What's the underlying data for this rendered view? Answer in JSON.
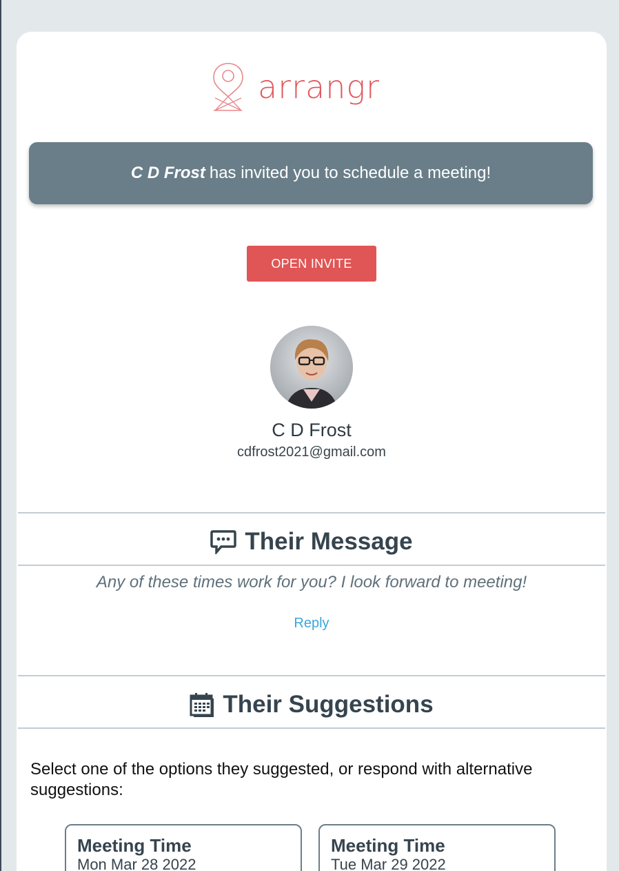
{
  "brand": {
    "name": "arrangr",
    "color": "#e05a5e"
  },
  "banner": {
    "inviter": "C D Frost",
    "text": "has invited you to schedule a meeting!"
  },
  "open_button": {
    "label": "OPEN INVITE"
  },
  "organizer": {
    "name": "C D Frost",
    "email": "cdfrost2021@gmail.com"
  },
  "message_section": {
    "title": "Their Message",
    "icon": "chat-bubble-icon",
    "message": "Any of these times work for you? I look forward to meeting!",
    "reply_label": "Reply"
  },
  "suggestions_section": {
    "title": "Their Suggestions",
    "icon": "calendar-icon",
    "instructions": "Select one of the options they suggested, or respond with alternative suggestions:",
    "options": [
      {
        "title": "Meeting Time",
        "date": "Mon Mar 28 2022"
      },
      {
        "title": "Meeting Time",
        "date": "Tue Mar 29 2022"
      }
    ]
  },
  "colors": {
    "banner": "#6a7e89",
    "button": "#e05555",
    "link": "#3aa6db"
  }
}
